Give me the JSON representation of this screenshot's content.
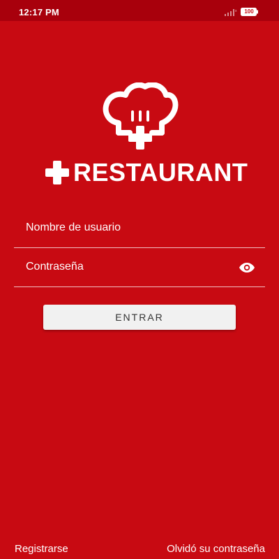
{
  "status_bar": {
    "time": "12:17 PM",
    "battery": "100",
    "icons": [
      "signal-icon",
      "battery-icon"
    ]
  },
  "branding": {
    "logo_icon": "chef-hat-plus-icon",
    "name": "RESTAURANT",
    "prefix_icon": "plus-icon"
  },
  "form": {
    "username_label": "Nombre de usuario",
    "password_label": "Contraseña",
    "password_toggle_icon": "eye-icon",
    "submit_label": "ENTRAR"
  },
  "footer": {
    "register_label": "Registrarse",
    "forgot_label": "Olvidó su contraseña"
  },
  "colors": {
    "background": "#C80A12",
    "status_bar": "#A8000C",
    "button": "#F1F1F1",
    "text": "#FFFFFF"
  }
}
